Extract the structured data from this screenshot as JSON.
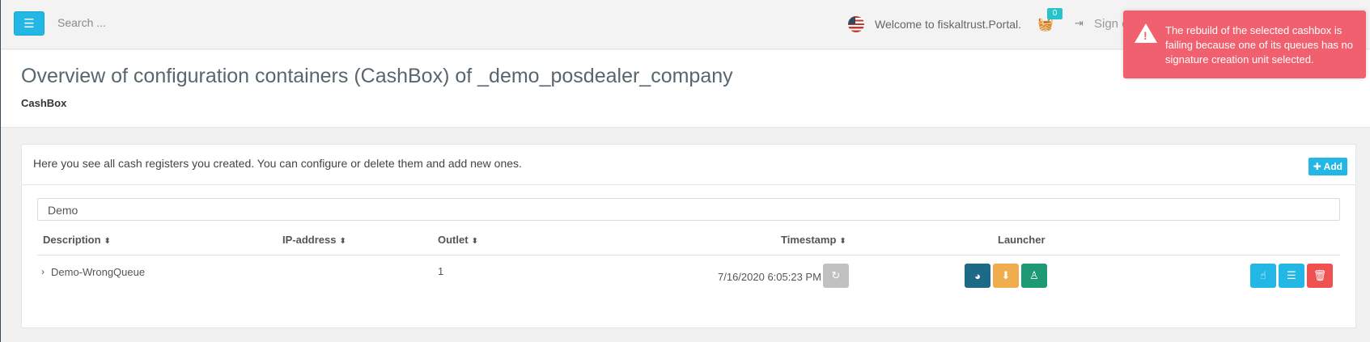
{
  "topbar": {
    "menu_icon": "hamburger-icon",
    "search_placeholder": "Search ...",
    "welcome": "Welcome to fiskaltrust.Portal.",
    "cart_count": "0",
    "signout": "Sign out"
  },
  "toast": {
    "type": "error",
    "message": "The rebuild of the selected cashbox is failing because one of its queues has no signature creation unit selected.",
    "color": "#f0606e"
  },
  "page": {
    "title": "Overview of configuration containers (CashBox) of _demo_posdealer_company",
    "subtitle": "CashBox"
  },
  "panel": {
    "description": "Here you see all cash registers you created. You can configure or delete them and add new ones.",
    "add_label": "Add",
    "filter_value": "Demo"
  },
  "table": {
    "columns": {
      "description": "Description",
      "ip": "IP-address",
      "outlet": "Outlet",
      "timestamp": "Timestamp",
      "launcher": "Launcher"
    },
    "rows": [
      {
        "description": "Demo-WrongQueue",
        "ip": "",
        "outlet": "1",
        "timestamp": "7/16/2020 6:05:23 PM"
      }
    ]
  },
  "colors": {
    "accent": "#23b7e5",
    "danger": "#f05050",
    "warning": "#f0ad4e",
    "success": "#1d9a73",
    "dark_teal": "#1d6a86"
  }
}
